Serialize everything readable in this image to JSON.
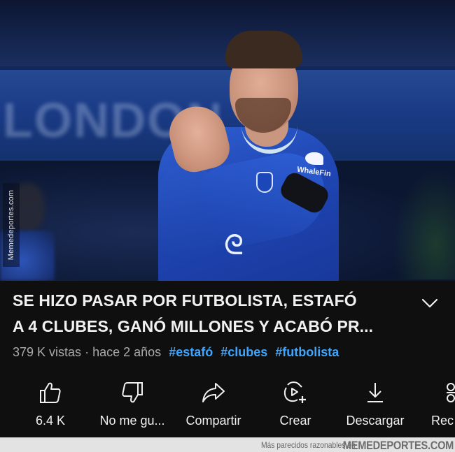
{
  "watermark": {
    "vertical_text": "Memedeportes.com"
  },
  "video": {
    "title_line1": "SE HIZO PASAR POR FUTBOLISTA, ESTAFÓ",
    "title_line2": "A 4 CLUBES, GANÓ MILLONES Y ACABÓ PR...",
    "views": "379 K vistas",
    "separator": "·",
    "published": "hace 2 años",
    "hashtags": [
      "#estafó",
      "#clubes",
      "#futbolista"
    ],
    "expand_icon": "chevron-down-icon",
    "thumbnail_sponsor": "WhaleFin"
  },
  "actions": [
    {
      "id": "like",
      "icon": "thumbs-up-icon",
      "label": "6.4 K"
    },
    {
      "id": "dislike",
      "icon": "thumbs-down-icon",
      "label": "No me gu..."
    },
    {
      "id": "share",
      "icon": "share-icon",
      "label": "Compartir"
    },
    {
      "id": "create",
      "icon": "create-icon",
      "label": "Crear"
    },
    {
      "id": "download",
      "icon": "download-icon",
      "label": "Descargar"
    },
    {
      "id": "remix",
      "icon": "remix-icon",
      "label": "Rec"
    }
  ],
  "footer": {
    "caption": "Más parecidos razonables en",
    "brand": "MEMEDEPORTES.COM"
  },
  "colors": {
    "background": "#0f0f0f",
    "text": "#f1f1f1",
    "meta_text": "#aaaaaa",
    "hashtag": "#3ea6ff",
    "footer_bg": "#e3e3e3"
  }
}
